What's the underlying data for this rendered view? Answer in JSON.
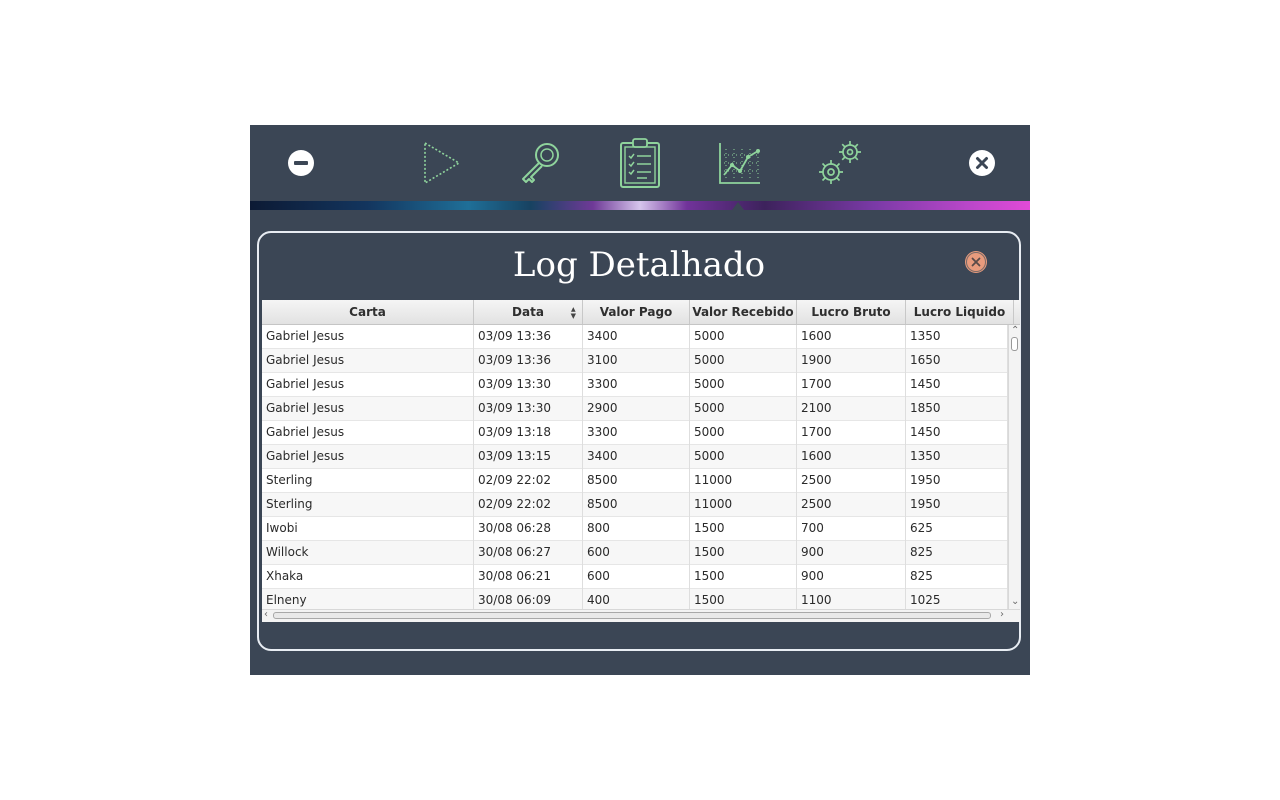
{
  "toolbar": {
    "icons": [
      "minimize-icon",
      "play-icon",
      "key-icon",
      "clipboard-log-icon",
      "chart-icon",
      "settings-gears-icon",
      "close-icon"
    ],
    "accent_color": "#8fd49c"
  },
  "panel": {
    "title": "Log Detalhado"
  },
  "table": {
    "columns": [
      "Carta",
      "Data",
      "Valor Pago",
      "Valor Recebido",
      "Lucro Bruto",
      "Lucro Liquido"
    ],
    "sorted_column": "Data",
    "rows": [
      [
        "Gabriel Jesus",
        "03/09 13:36",
        "3400",
        "5000",
        "1600",
        "1350"
      ],
      [
        "Gabriel Jesus",
        "03/09 13:36",
        "3100",
        "5000",
        "1900",
        "1650"
      ],
      [
        "Gabriel Jesus",
        "03/09 13:30",
        "3300",
        "5000",
        "1700",
        "1450"
      ],
      [
        "Gabriel Jesus",
        "03/09 13:30",
        "2900",
        "5000",
        "2100",
        "1850"
      ],
      [
        "Gabriel Jesus",
        "03/09 13:18",
        "3300",
        "5000",
        "1700",
        "1450"
      ],
      [
        "Gabriel Jesus",
        "03/09 13:15",
        "3400",
        "5000",
        "1600",
        "1350"
      ],
      [
        "Sterling",
        "02/09 22:02",
        "8500",
        "11000",
        "2500",
        "1950"
      ],
      [
        "Sterling",
        "02/09 22:02",
        "8500",
        "11000",
        "2500",
        "1950"
      ],
      [
        "Iwobi",
        "30/08 06:28",
        "800",
        "1500",
        "700",
        "625"
      ],
      [
        "Willock",
        "30/08 06:27",
        "600",
        "1500",
        "900",
        "825"
      ],
      [
        "Xhaka",
        "30/08 06:21",
        "600",
        "1500",
        "900",
        "825"
      ],
      [
        "Elneny",
        "30/08 06:09",
        "400",
        "1500",
        "1100",
        "1025"
      ]
    ]
  }
}
